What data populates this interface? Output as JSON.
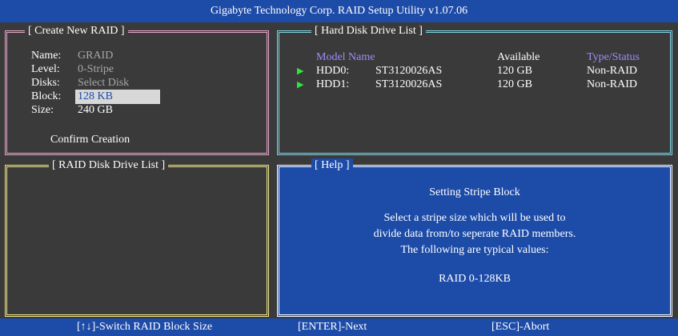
{
  "window": {
    "title": "Gigabyte Technology Corp.  RAID Setup Utility  v1.07.06"
  },
  "create_raid": {
    "title": "[ Create New RAID ]",
    "fields": [
      {
        "label": "Name:",
        "value": "GRAID"
      },
      {
        "label": "Level:",
        "value": "0-Stripe"
      },
      {
        "label": "Disks:",
        "value": "Select Disk"
      },
      {
        "label": "Block:",
        "value": "128 KB"
      },
      {
        "label": "Size:",
        "value": "240 GB"
      }
    ],
    "confirm_label": "Confirm Creation"
  },
  "hdd_list": {
    "title": "[ Hard Disk Drive List ]",
    "headers": {
      "model": "Model Name",
      "available": "Available",
      "type": "Type/Status"
    },
    "rows": [
      {
        "slot": "HDD0:",
        "model": "ST3120026AS",
        "available": "120 GB",
        "type": "Non-RAID"
      },
      {
        "slot": "HDD1:",
        "model": "ST3120026AS",
        "available": "120 GB",
        "type": "Non-RAID"
      }
    ]
  },
  "raid_disk_list": {
    "title": "[ RAID Disk Drive List ]"
  },
  "help": {
    "title": "[ Help ]",
    "heading": "Setting Stripe Block",
    "lines": [
      "Select a stripe size which will be used to",
      "divide data from/to seperate RAID members.",
      "The following are typical values:"
    ],
    "example": "RAID 0-128KB"
  },
  "status_bar": {
    "switch": "[↑↓]-Switch RAID Block Size",
    "next": "[ENTER]-Next",
    "abort": "[ESC]-Abort"
  },
  "colors": {
    "background": "#3a3a3a",
    "bar_blue": "#1d4ba8",
    "create_border": "#e8a8cc",
    "hdd_border": "#7fd6e4",
    "raidlist_border": "#f2ea8a",
    "header_lavender": "#9b8cff",
    "arrow_green": "#2ee63a"
  }
}
